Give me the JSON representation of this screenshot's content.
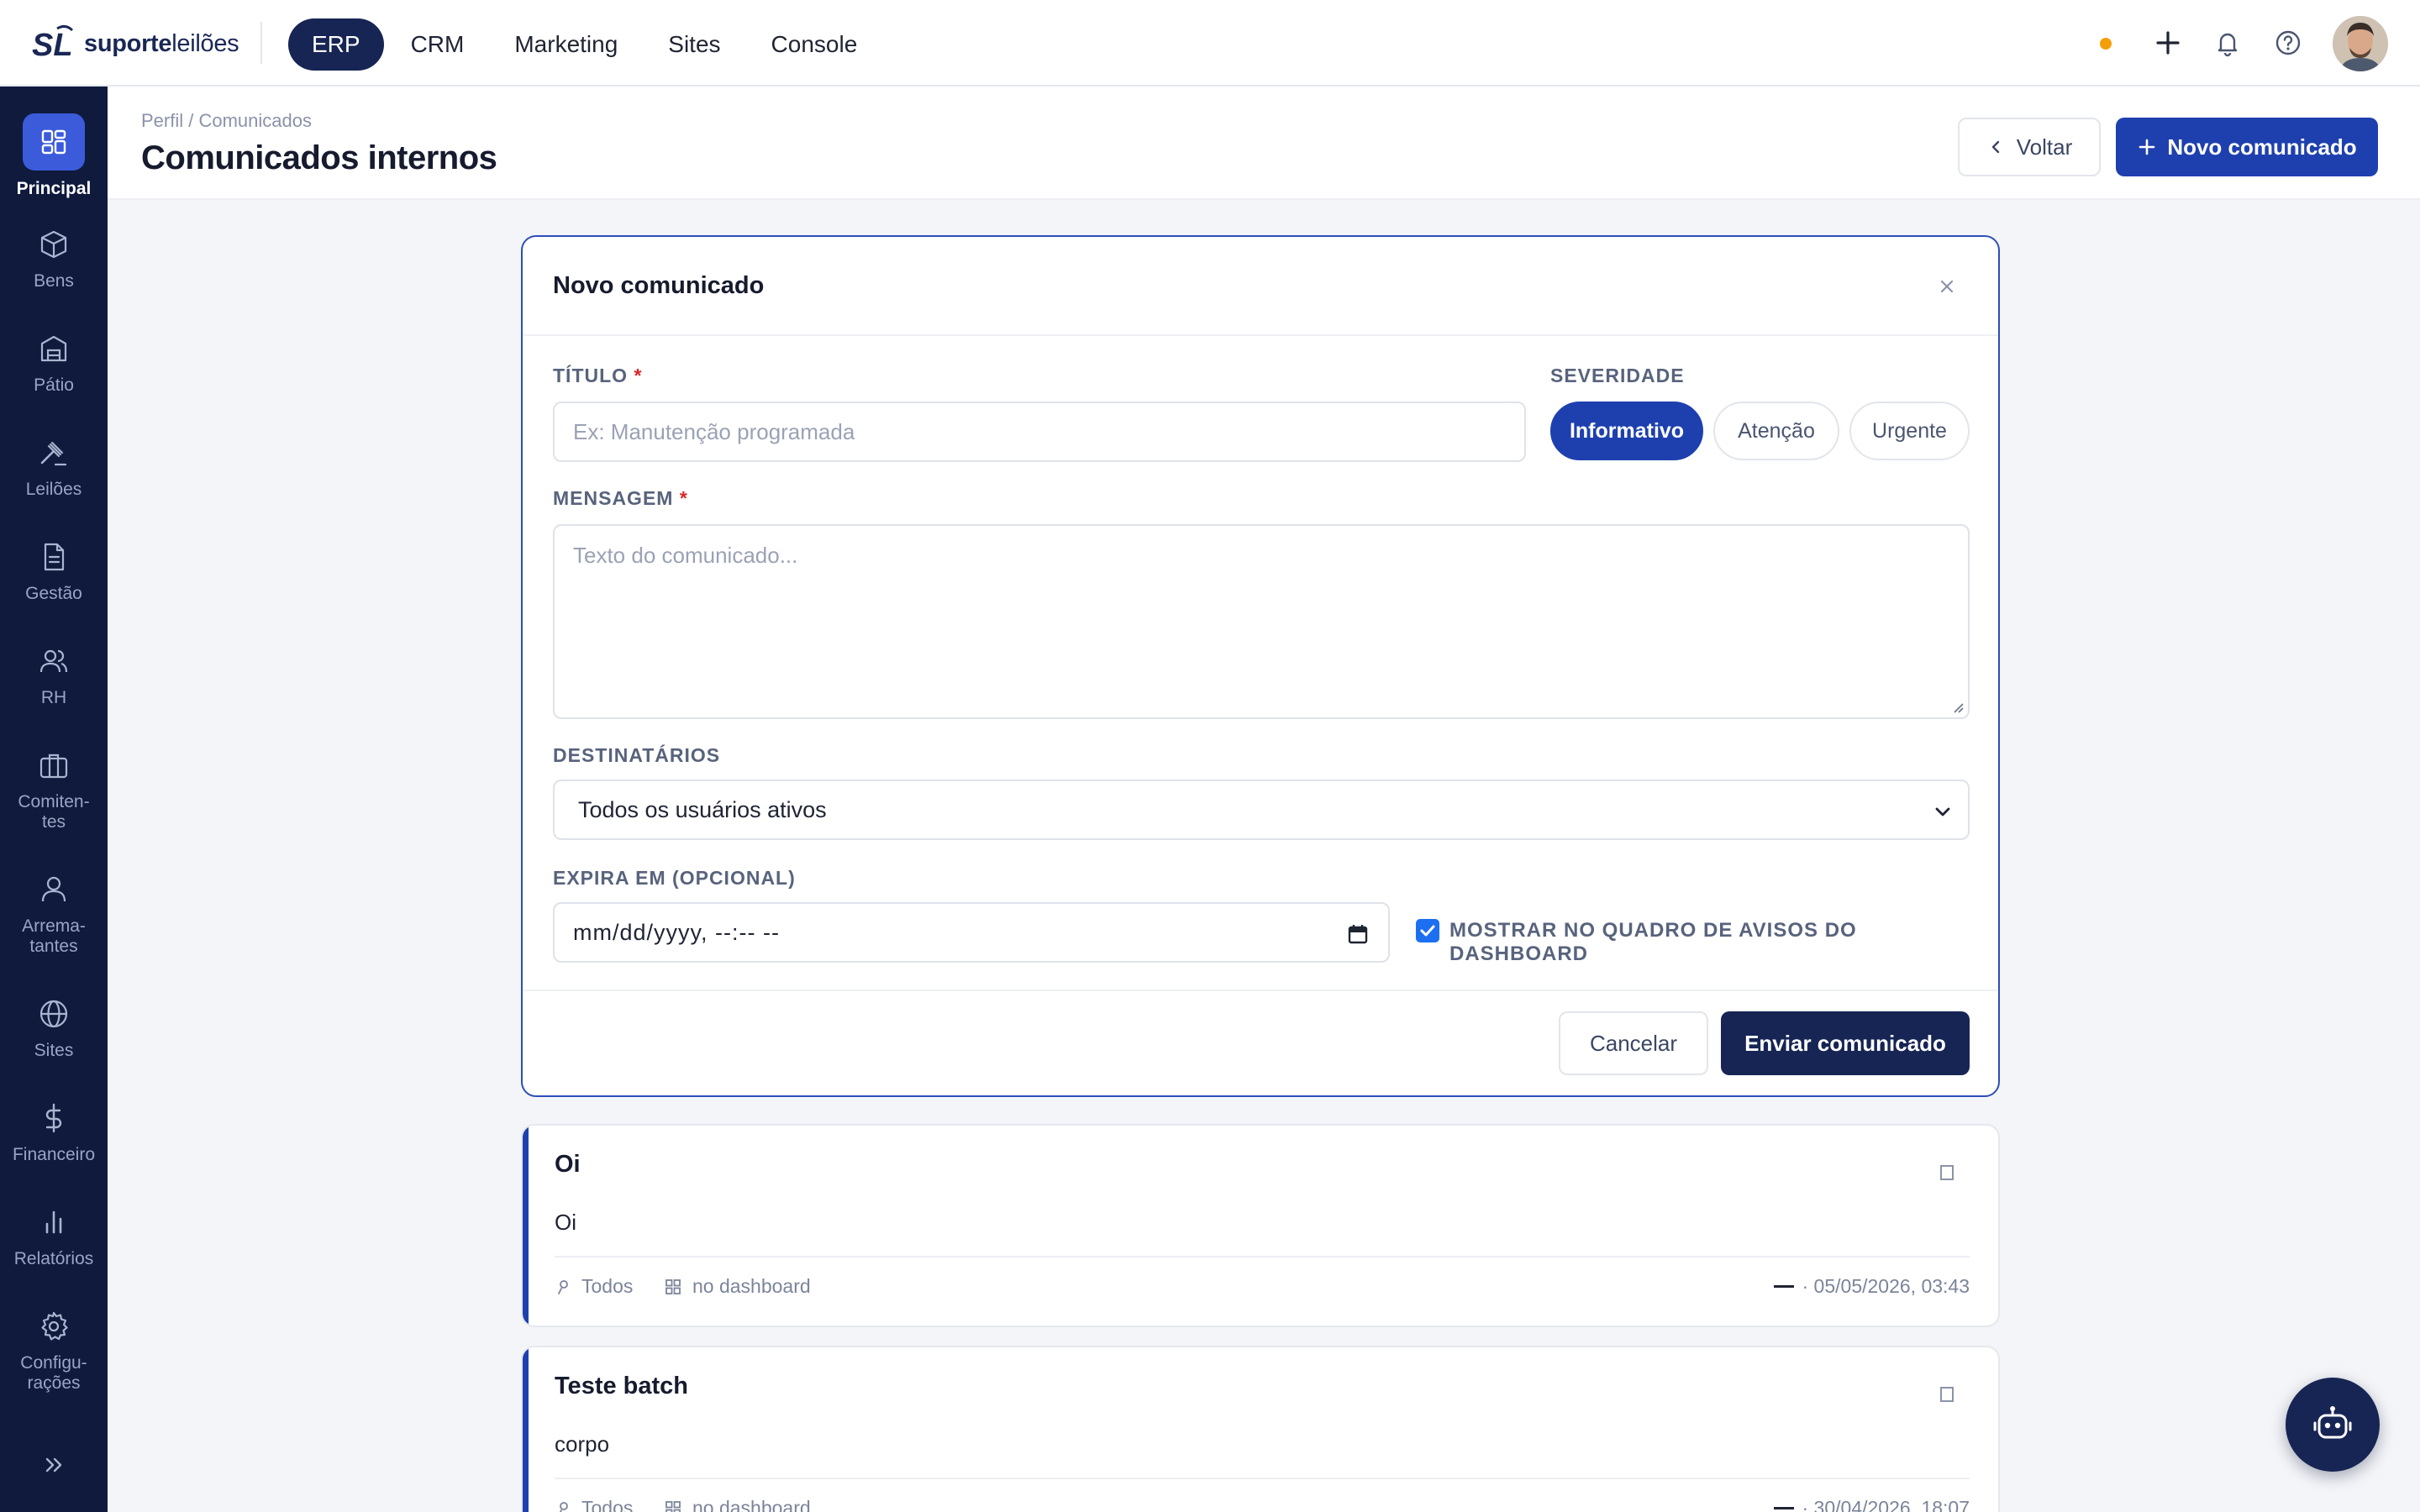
{
  "brand": {
    "name_bold": "suporte",
    "name_light": "leilões",
    "mark": "SL"
  },
  "topnav": [
    {
      "label": "ERP",
      "active": true
    },
    {
      "label": "CRM",
      "active": false
    },
    {
      "label": "Marketing",
      "active": false
    },
    {
      "label": "Sites",
      "active": false
    },
    {
      "label": "Console",
      "active": false
    }
  ],
  "topbar_icons": [
    "status-dot",
    "plus-icon",
    "bell-icon",
    "help-icon",
    "avatar"
  ],
  "sidebar": {
    "items": [
      {
        "label": "Principal",
        "icon": "dashboard-icon",
        "active": true
      },
      {
        "label": "Bens",
        "icon": "box-icon"
      },
      {
        "label": "Pátio",
        "icon": "warehouse-icon"
      },
      {
        "label": "Leilões",
        "icon": "gavel-icon"
      },
      {
        "label": "Gestão",
        "icon": "document-icon"
      },
      {
        "label": "RH",
        "icon": "users-icon"
      },
      {
        "label": "Comiten-\ntes",
        "icon": "briefcase-icon"
      },
      {
        "label": "Arrema-\ntantes",
        "icon": "user-icon"
      },
      {
        "label": "Sites",
        "icon": "globe-icon"
      },
      {
        "label": "Financeiro",
        "icon": "dollar-icon"
      },
      {
        "label": "Relatórios",
        "icon": "bar-chart-icon"
      },
      {
        "label": "Configu-\nrações",
        "icon": "gear-icon"
      }
    ],
    "collapse_icon": "chevrons-right-icon"
  },
  "header": {
    "breadcrumb": "Perfil / Comunicados",
    "title": "Comunicados internos",
    "back_label": "Voltar",
    "new_label": "Novo comunicado"
  },
  "form": {
    "title": "Novo comunicado",
    "title_label": "TÍTULO",
    "title_placeholder": "Ex: Manutenção programada",
    "severity_label": "SEVERIDADE",
    "severity_options": [
      {
        "label": "Informativo",
        "active": true
      },
      {
        "label": "Atenção",
        "active": false
      },
      {
        "label": "Urgente",
        "active": false
      }
    ],
    "message_label": "MENSAGEM",
    "message_placeholder": "Texto do comunicado...",
    "recipients_label": "DESTINATÁRIOS",
    "recipients_value": "Todos os usuários ativos",
    "expires_label": "EXPIRA EM (OPCIONAL)",
    "expires_value": "mm/dd/yyyy, --:-- --",
    "dashboard_checkbox_label": "MOSTRAR NO QUADRO DE AVISOS DO DASHBOARD",
    "dashboard_checked": true,
    "required_mark": "*",
    "cancel_label": "Cancelar",
    "submit_label": "Enviar comunicado"
  },
  "notices": [
    {
      "title": "Oi",
      "body": "Oi",
      "audience": "Todos",
      "placement": "no dashboard",
      "date": "· 05/05/2026, 03:43"
    },
    {
      "title": "Teste batch",
      "body": "corpo",
      "audience": "Todos",
      "placement": "no dashboard",
      "date": "· 30/04/2026, 18:07"
    }
  ],
  "colors": {
    "primary": "#1e40af",
    "navy": "#172554",
    "sidebar": "#0f1a3d",
    "sidebar_active": "#3b5bdb",
    "status_dot": "#f59e0b",
    "required": "#dc2626"
  }
}
